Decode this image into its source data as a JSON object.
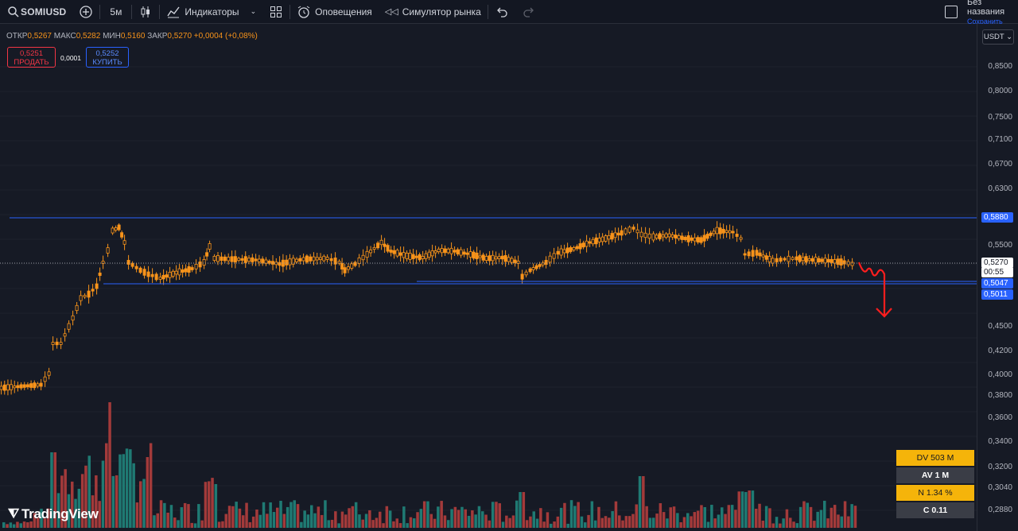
{
  "toolbar": {
    "symbol": "SOMIUSD",
    "interval": "5м",
    "indicators": "Индикаторы",
    "alerts": "Оповещения",
    "replay": "Симулятор рынка",
    "layout_name": "Без названия",
    "saved": "Сохранить"
  },
  "legend": {
    "open_label": "ОТКР",
    "open": "0,5267",
    "high_label": "МАКС",
    "high": "0,5282",
    "low_label": "МИН",
    "low": "0,5160",
    "close_label": "ЗАКР",
    "close": "0,5270",
    "change": "+0,0004 (+0,08%)"
  },
  "trade": {
    "sell_price": "0,5251",
    "sell_label": "ПРОДАТЬ",
    "spread": "0,0001",
    "buy_price": "0,5252",
    "buy_label": "КУПИТЬ"
  },
  "currency": "USDT",
  "price_axis": {
    "ticks": [
      "0,8500",
      "0,8000",
      "0,7500",
      "0,7100",
      "0,6700",
      "0,6300",
      "0,5500",
      "0,4500",
      "0,4200",
      "0,4000",
      "0,3800",
      "0,3600",
      "0,3400",
      "0,3200",
      "0,3040",
      "0,2880"
    ],
    "resistance_label": "0,5880",
    "last_price": "0,5270",
    "timer": "00:55",
    "support1_label": "0,5047",
    "support2_label": "0,5011"
  },
  "branding": {
    "logo_text": "TradingView"
  },
  "stats": [
    {
      "text": "DV 503 M",
      "color": "#f5b40a"
    },
    {
      "text": "AV 1 M",
      "color": "#3a3d46"
    },
    {
      "text": "N 1.34 %",
      "color": "#f5b40a"
    },
    {
      "text": "C  0.11",
      "color": "#3a3d46"
    }
  ],
  "colors": {
    "candle": "#f7931a",
    "level_line": "#2962ff",
    "vol_up": "#26a69a",
    "vol_down": "#ef5350",
    "annotation": "#ff1e1e"
  }
}
